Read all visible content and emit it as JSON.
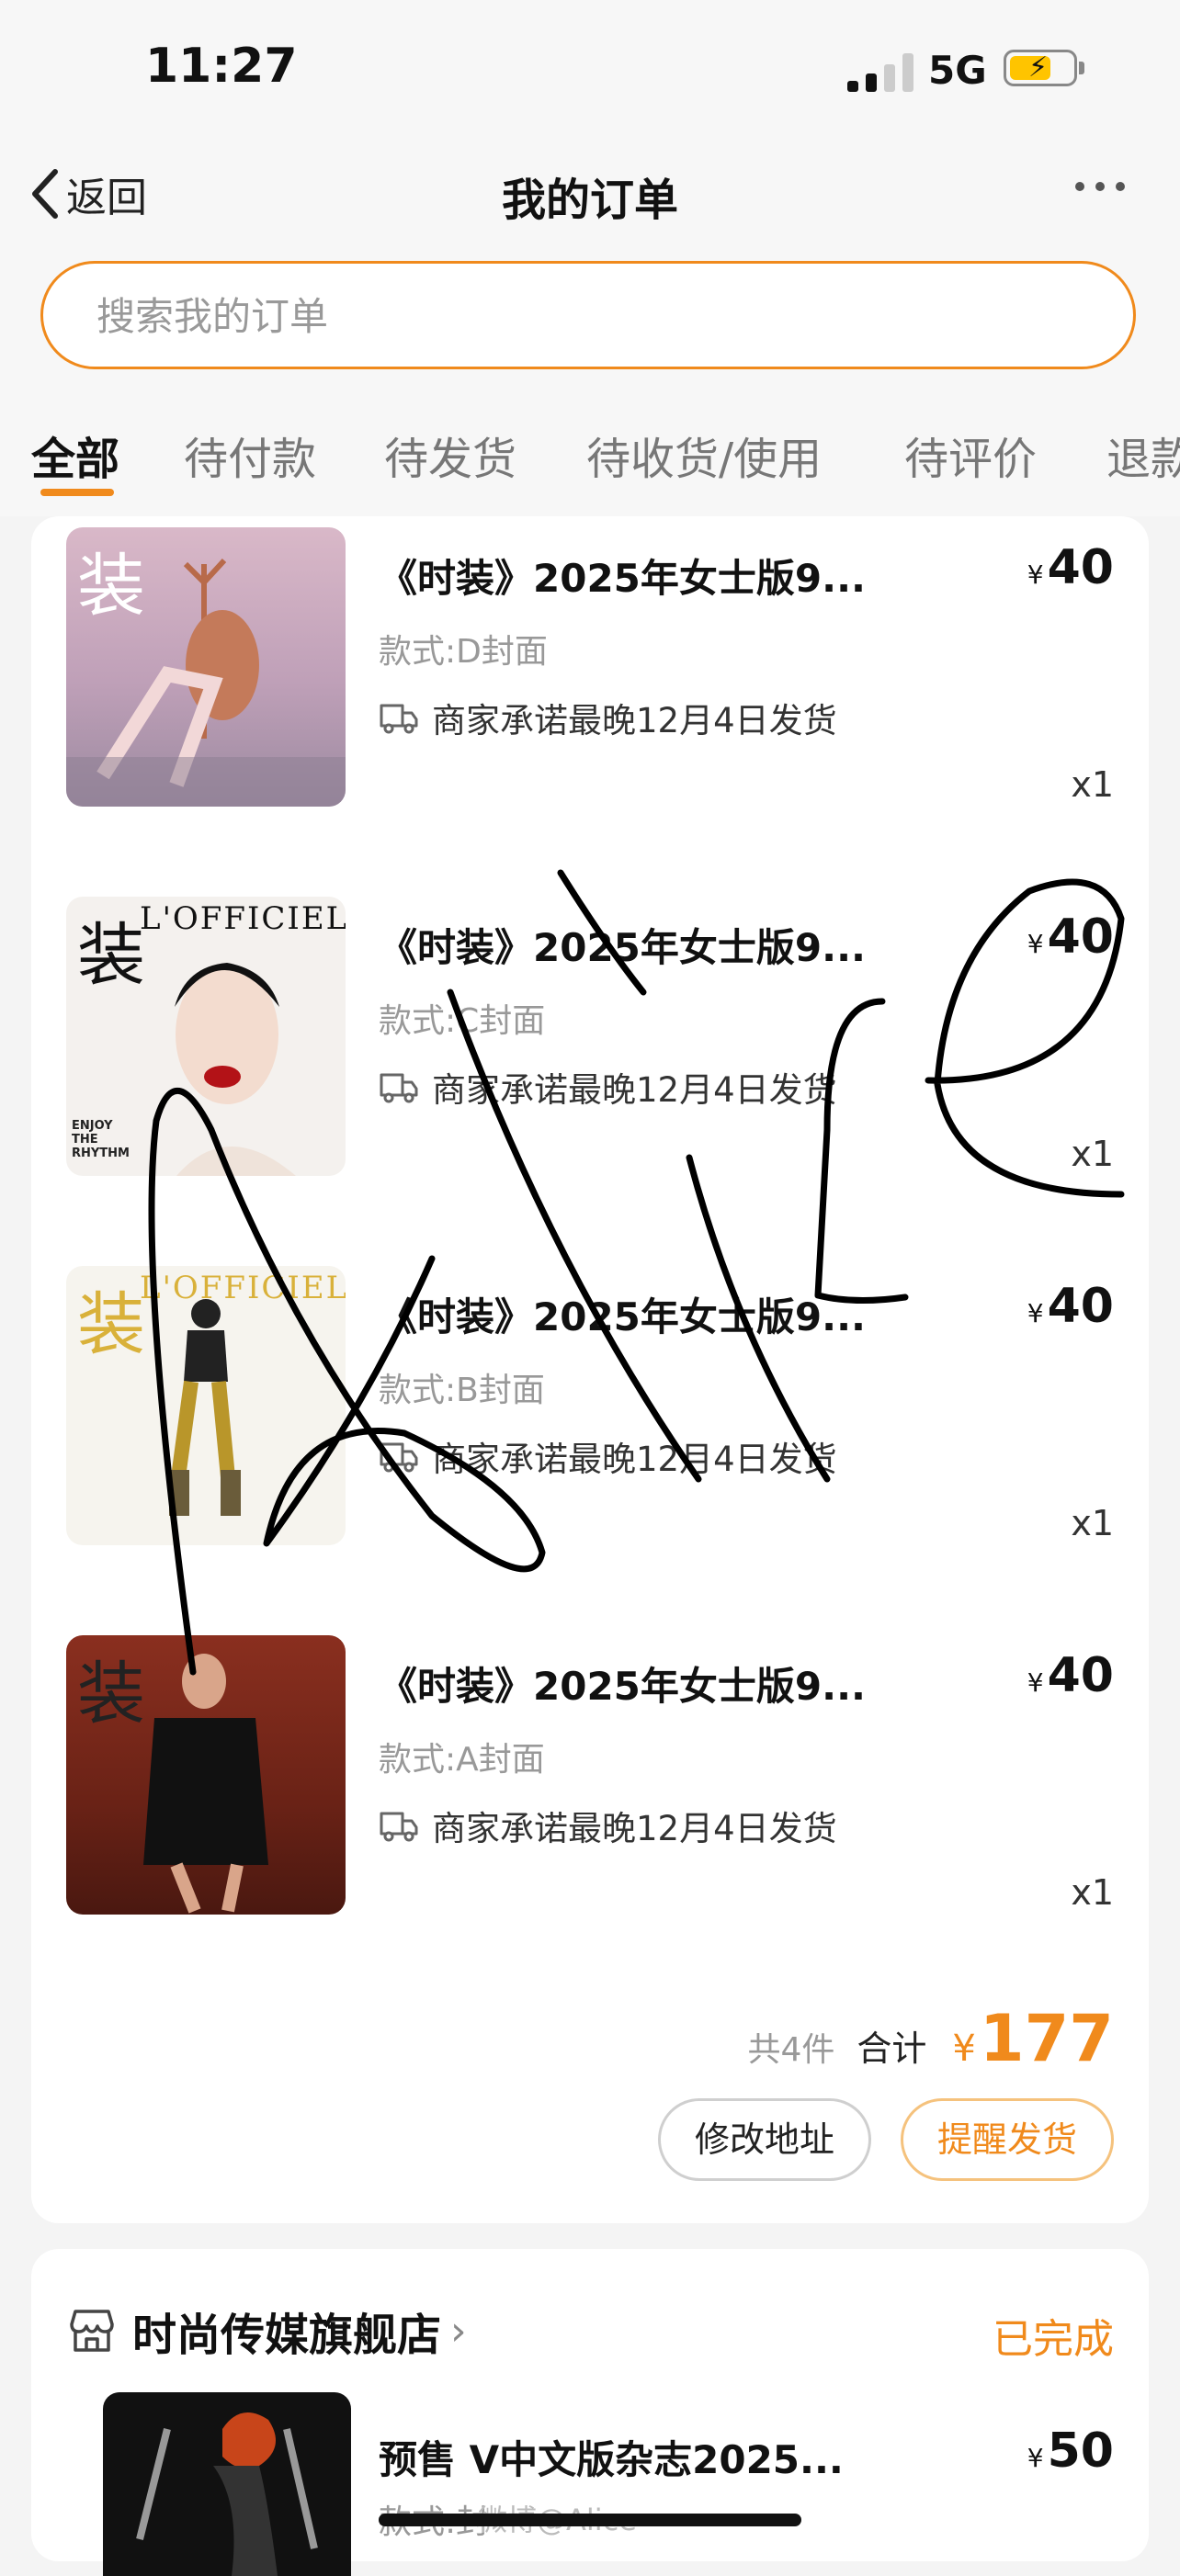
{
  "status_bar": {
    "time": "11:27",
    "network": "5G"
  },
  "nav": {
    "back_label": "返回",
    "title": "我的订单"
  },
  "search": {
    "placeholder": "搜索我的订单"
  },
  "tabs": [
    "全部",
    "待付款",
    "待发货",
    "待收货/使用",
    "待评价",
    "退款"
  ],
  "orders": [
    {
      "items": [
        {
          "title": "《时装》2025年女士版9...",
          "currency": "¥",
          "price": "40",
          "spec": "款式:D封面",
          "shipping": "商家承诺最晚12月4日发货",
          "qty": "x1",
          "cover_char": "装"
        },
        {
          "title": "《时装》2025年女士版9...",
          "currency": "¥",
          "price": "40",
          "spec": "款式:C封面",
          "shipping": "商家承诺最晚12月4日发货",
          "qty": "x1",
          "cover_char": "装",
          "cover_masthead": "L'OFFICIEL",
          "cover_text": "ENJOY THE RHYTHM"
        },
        {
          "title": "《时装》2025年女士版9...",
          "currency": "¥",
          "price": "40",
          "spec": "款式:B封面",
          "shipping": "商家承诺最晚12月4日发货",
          "qty": "x1",
          "cover_char": "装",
          "cover_masthead": "L'OFFICIEL"
        },
        {
          "title": "《时装》2025年女士版9...",
          "currency": "¥",
          "price": "40",
          "spec": "款式:A封面",
          "shipping": "商家承诺最晚12月4日发货",
          "qty": "x1",
          "cover_char": "装"
        }
      ],
      "count_label": "共4件",
      "total_label": "合计",
      "total_currency": "¥",
      "total": "177",
      "buttons": {
        "change_address": "修改地址",
        "remind_ship": "提醒发货"
      }
    },
    {
      "shop_name": "时尚传媒旗舰店",
      "status": "已完成",
      "items": [
        {
          "title": "预售 V中文版杂志2025...",
          "currency": "¥",
          "price": "50",
          "spec": "款式:封"
        }
      ]
    }
  ],
  "watermark": "微博@Alice",
  "colors": {
    "accent": "#f08a1c",
    "card": "#ffffff",
    "background": "#f4f4f4"
  }
}
